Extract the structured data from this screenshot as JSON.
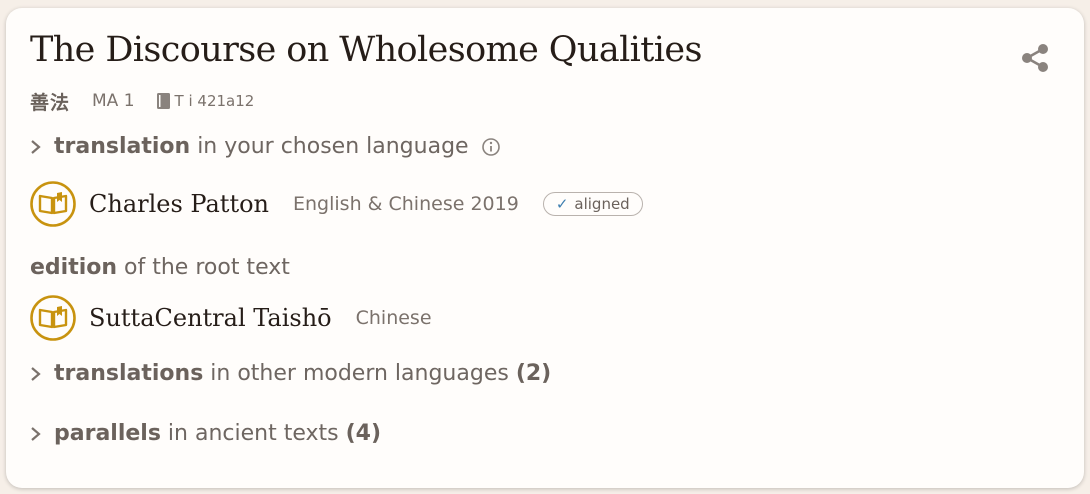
{
  "header": {
    "title": "The Discourse on Wholesome Qualities",
    "original_title": "善法",
    "uid": "MA 1",
    "reference": "T i 421a12"
  },
  "icons": {
    "share": "share-icon",
    "book": "book-icon",
    "chevron": "chevron-right-icon",
    "info": "info-icon",
    "publication": "open-book-icon"
  },
  "colors": {
    "accent": "#c8930f",
    "text_muted": "#6b625c",
    "check": "#3f7fb0"
  },
  "translation_section": {
    "label_bold": "translation",
    "label_rest": " in your chosen language"
  },
  "translation": {
    "author": "Charles Patton",
    "language_year": "English & Chinese 2019",
    "badge_check": "✓",
    "badge_label": "aligned"
  },
  "edition_section": {
    "label_bold": "edition",
    "label_rest": " of the root text"
  },
  "root_edition": {
    "author": "SuttaCentral Taishō",
    "language": "Chinese"
  },
  "other_translations": {
    "label_bold": "translations",
    "label_rest": " in other modern languages ",
    "count": "(2)"
  },
  "parallels": {
    "label_bold": "parallels",
    "label_rest": " in ancient texts ",
    "count": "(4)"
  }
}
